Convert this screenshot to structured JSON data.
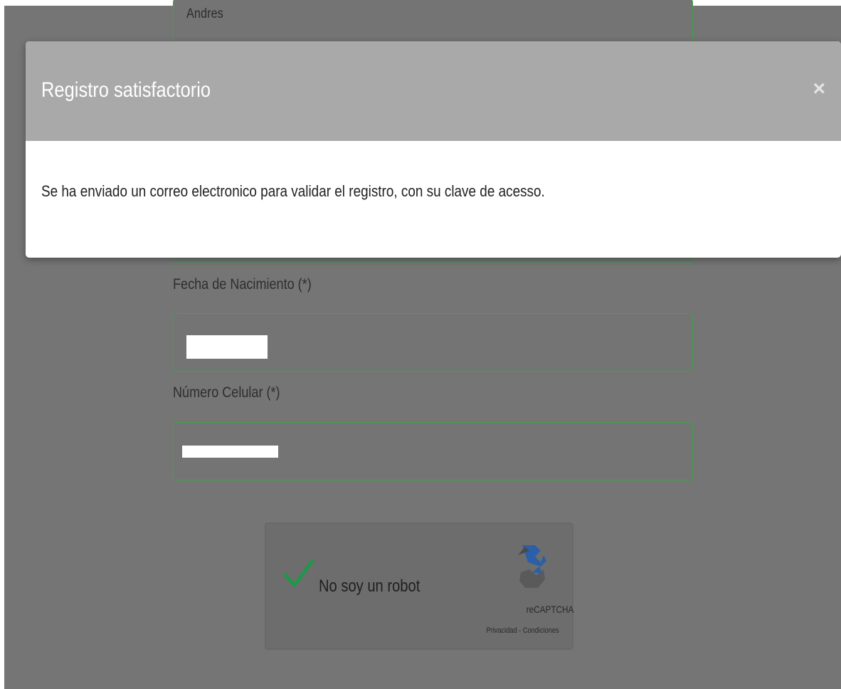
{
  "form": {
    "name_value": "Andres",
    "birthdate_label": "Fecha de Nacimiento (*)",
    "phone_label": "Número Celular (*)"
  },
  "captcha": {
    "label": "No soy un robot",
    "brand": "reCAPTCHA",
    "links": "Privacidad - Condiciones",
    "checked": true
  },
  "modal": {
    "title": "Registro satisfactorio",
    "close_symbol": "×",
    "message": "Se ha enviado un correo electronico para validar el registro, con su clave de acesso."
  },
  "colors": {
    "overlay": "#757575",
    "field_border": "#3fa14b",
    "check": "#1a9a47",
    "modal_header": "#a9a9a9"
  }
}
